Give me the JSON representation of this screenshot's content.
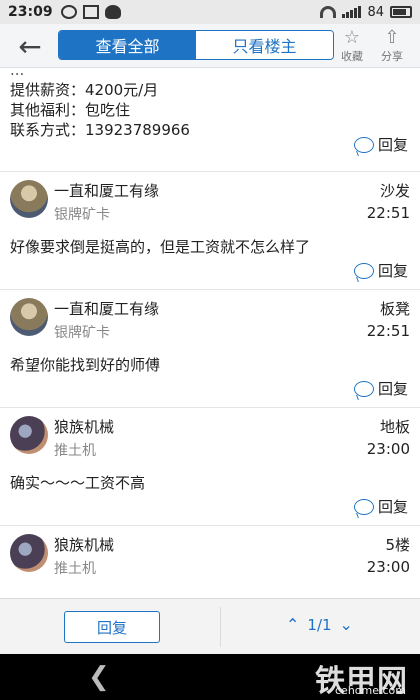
{
  "status": {
    "time": "23:09",
    "battery": "84"
  },
  "nav": {
    "tab_all": "查看全部",
    "tab_author": "只看楼主",
    "collect_label": "收藏",
    "share_label": "分享"
  },
  "info": {
    "partial_line": "...",
    "salary": "提供薪资：4200元/月",
    "benefits": "其他福利：包吃住",
    "contact": "联系方式：13923789966",
    "reply_label": "回复"
  },
  "posts": [
    {
      "author": "一直和厦工有缘",
      "rank": "银牌矿卡",
      "floor": "沙发",
      "time": "22:51",
      "text": "好像要求倒是挺高的，但是工资就不怎么样了",
      "reply": "回复"
    },
    {
      "author": "一直和厦工有缘",
      "rank": "银牌矿卡",
      "floor": "板凳",
      "time": "22:51",
      "text": "希望你能找到好的师傅",
      "reply": "回复"
    },
    {
      "author": "狼族机械",
      "rank": "推土机",
      "floor": "地板",
      "time": "23:00",
      "text": "确实～～～工资不高",
      "reply": "回复"
    },
    {
      "author": "狼族机械",
      "rank": "推土机",
      "floor": "5楼",
      "time": "23:00",
      "text": "",
      "reply": ""
    }
  ],
  "bottom": {
    "reply_button": "回复",
    "page": "1/1"
  },
  "watermark": {
    "logo": "铁甲网",
    "domain": "cehome.com"
  },
  "colors": {
    "accent": "#1f73c4"
  },
  "icons": [
    "back-arrow-icon",
    "star-icon",
    "share-icon",
    "reply-bubble-icon",
    "chevron-up-icon",
    "chevron-down-icon"
  ]
}
